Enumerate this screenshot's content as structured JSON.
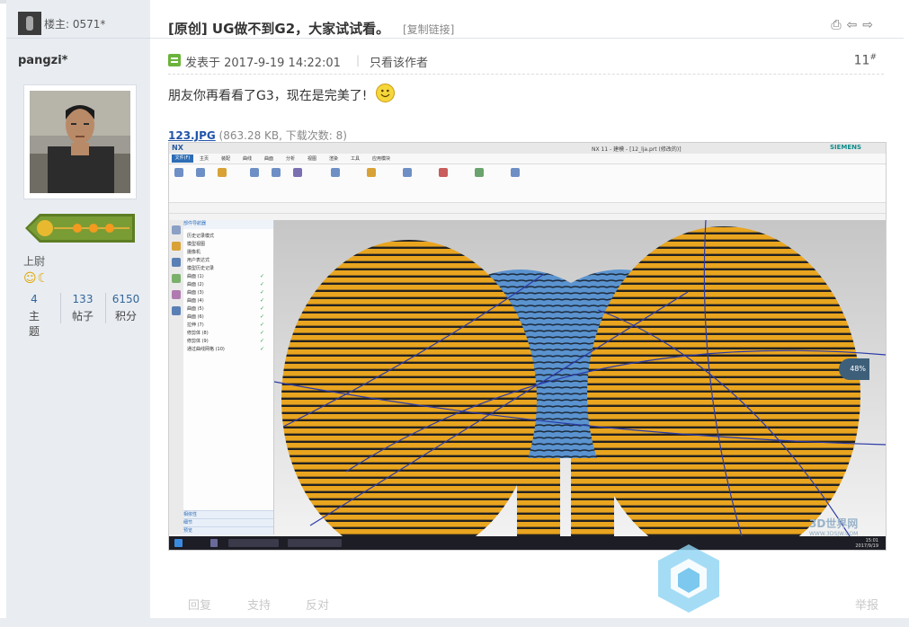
{
  "sidebar": {
    "floor_label": "楼主: 0571*",
    "username": "pangzi*",
    "rank": "上尉",
    "stats": [
      {
        "value": "4",
        "label": "主题"
      },
      {
        "value": "133",
        "label": "帖子"
      },
      {
        "value": "6150",
        "label": "积分"
      }
    ]
  },
  "post": {
    "title": "[原创] UG做不到G2，大家试试看。",
    "copy_link": "[复制链接]",
    "posted_at": "发表于 2017-9-19 14:22:01",
    "separator": "|",
    "only_author": "只看该作者",
    "floor_number": "11",
    "floor_suffix": "#",
    "content": "朋友你再看看了G3，现在是完美了!",
    "attachment": {
      "name": "123.JPG",
      "info": "(863.28 KB, 下载次数: 8)"
    }
  },
  "screenshot": {
    "app_logo": "NX",
    "app_title": "NX 11 - 建模 - [12_lja.prt  (修改的)]",
    "brand": "SIEMENS",
    "file_tab": "文件(F)",
    "menus": [
      "主页",
      "装配",
      "曲线",
      "曲面",
      "分析",
      "视图",
      "渲染",
      "工具",
      "应用模块"
    ],
    "nav_title": "部件导航器",
    "nav_rows": [
      "历史记录模式",
      "模型视图",
      "摄像机",
      "用户表达式",
      "模型历史记录",
      "曲面 (1)",
      "曲面 (2)",
      "曲面 (3)",
      "曲面 (4)",
      "曲面 (5)",
      "曲面 (6)",
      "拉伸 (7)",
      "修剪体 (8)",
      "修剪体 (9)",
      "通过曲线网格 (10)"
    ],
    "nav_bottom": [
      "相依性",
      "细节",
      "预览"
    ],
    "zoom_badge": "48%",
    "clock_time": "15:01",
    "clock_date": "2017/9/19",
    "watermark": "3D世界网",
    "watermark_url": "WWW.3DSJW.COM"
  },
  "actions": {
    "reply": "回复",
    "support": "支持",
    "oppose": "反对",
    "report": "举报"
  },
  "colors": {
    "surface_yellow": "#e9a51f",
    "surface_blue": "#5a93cf",
    "link_blue": "#2255aa",
    "taskbar": "#1d1d25"
  }
}
